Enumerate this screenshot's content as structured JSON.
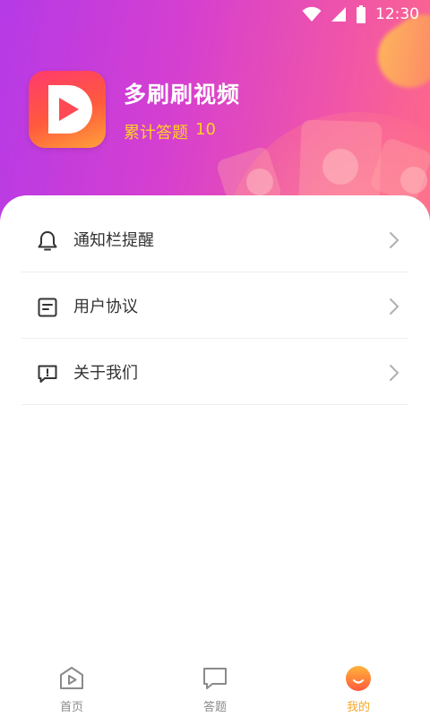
{
  "status_bar": {
    "time": "12:30"
  },
  "profile": {
    "app_name": "多刷刷视频",
    "answer_label": "累计答题",
    "answer_count": "10"
  },
  "menu": {
    "items": [
      {
        "label": "通知栏提醒",
        "icon": "bell-icon"
      },
      {
        "label": "用户协议",
        "icon": "document-icon"
      },
      {
        "label": "关于我们",
        "icon": "info-message-icon"
      }
    ]
  },
  "bottom_nav": {
    "items": [
      {
        "label": "首页",
        "icon": "home-play-icon",
        "active": false
      },
      {
        "label": "答题",
        "icon": "chat-bubble-icon",
        "active": false
      },
      {
        "label": "我的",
        "icon": "smile-avatar-icon",
        "active": true
      }
    ]
  },
  "colors": {
    "header_start": "#b53ae6",
    "header_end": "#ff6a86",
    "accent_yellow": "#ffd21f",
    "active_tab": "#f7a928"
  }
}
